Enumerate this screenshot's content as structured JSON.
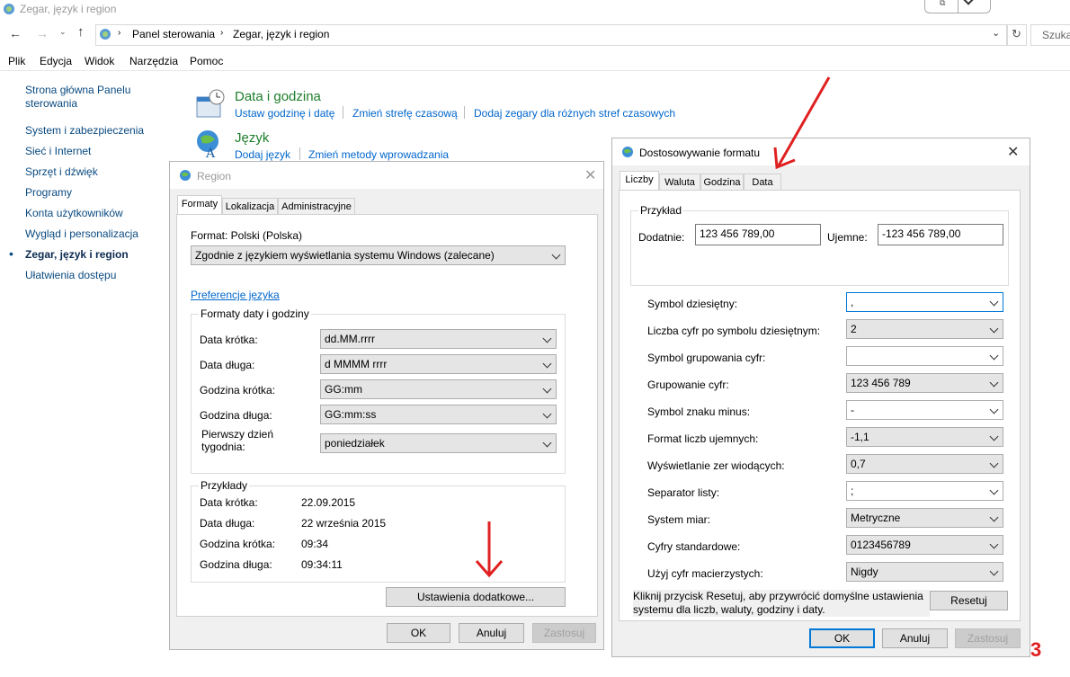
{
  "window": {
    "title": "Zegar, język i region",
    "search_placeholder": "Szuka"
  },
  "breadcrumb": {
    "root": "Panel sterowania",
    "current": "Zegar, język i region"
  },
  "menu": [
    "Plik",
    "Edycja",
    "Widok",
    "Narzędzia",
    "Pomoc"
  ],
  "sidebar": [
    {
      "label": "Strona główna Panelu sterowania"
    },
    {
      "label": "System i zabezpieczenia"
    },
    {
      "label": "Sieć i Internet"
    },
    {
      "label": "Sprzęt i dźwięk"
    },
    {
      "label": "Programy"
    },
    {
      "label": "Konta użytkowników"
    },
    {
      "label": "Wygląd i personalizacja"
    },
    {
      "label": "Zegar, język i region"
    },
    {
      "label": "Ułatwienia dostępu"
    }
  ],
  "categories": {
    "datetime": {
      "title": "Data i godzina",
      "links": [
        "Ustaw godzinę i datę",
        "Zmień strefę czasową",
        "Dodaj zegary dla różnych stref czasowych"
      ]
    },
    "language": {
      "title": "Język",
      "links": [
        "Dodaj język",
        "Zmień metody wprowadzania"
      ]
    }
  },
  "region": {
    "title": "Region",
    "tabs": [
      "Formaty",
      "Lokalizacja",
      "Administracyjne"
    ],
    "format_label": "Format: Polski (Polska)",
    "format_value": "Zgodnie z językiem wyświetlania systemu Windows (zalecane)",
    "pref_link": "Preferencje języka",
    "formats_group": "Formaty daty i godziny",
    "fields": [
      {
        "label": "Data krótka:",
        "value": "dd.MM.rrrr"
      },
      {
        "label": "Data długa:",
        "value": "d MMMM rrrr"
      },
      {
        "label": "Godzina krótka:",
        "value": "GG:mm"
      },
      {
        "label": "Godzina długa:",
        "value": "GG:mm:ss"
      },
      {
        "label": "Pierwszy dzień tygodnia:",
        "value": "poniedziałek"
      }
    ],
    "examples_group": "Przykłady",
    "examples": [
      {
        "label": "Data krótka:",
        "value": "22.09.2015"
      },
      {
        "label": "Data długa:",
        "value": "22 września 2015"
      },
      {
        "label": "Godzina krótka:",
        "value": "09:34"
      },
      {
        "label": "Godzina długa:",
        "value": "09:34:11"
      }
    ],
    "advanced_button": "Ustawienia dodatkowe...",
    "ok": "OK",
    "cancel": "Anuluj",
    "apply": "Zastosuj"
  },
  "custom": {
    "title": "Dostosowywanie formatu",
    "tabs": [
      "Liczby",
      "Waluta",
      "Godzina",
      "Data"
    ],
    "example_group": "Przykład",
    "positive_label": "Dodatnie:",
    "positive_value": "123 456 789,00",
    "negative_label": "Ujemne:",
    "negative_value": "-123 456 789,00",
    "rows": [
      {
        "label": "Symbol dziesiętny:",
        "value": ","
      },
      {
        "label": "Liczba cyfr po symbolu dziesiętnym:",
        "value": "2"
      },
      {
        "label": "Symbol grupowania cyfr:",
        "value": ""
      },
      {
        "label": "Grupowanie cyfr:",
        "value": "123 456 789"
      },
      {
        "label": "Symbol znaku minus:",
        "value": "-"
      },
      {
        "label": "Format liczb ujemnych:",
        "value": "-1,1"
      },
      {
        "label": "Wyświetlanie zer wiodących:",
        "value": "0,7"
      },
      {
        "label": "Separator listy:",
        "value": ";"
      },
      {
        "label": "System miar:",
        "value": "Metryczne"
      },
      {
        "label": "Cyfry standardowe:",
        "value": "0123456789"
      },
      {
        "label": "Użyj cyfr macierzystych:",
        "value": "Nigdy"
      }
    ],
    "reset_text": "Kliknij przycisk Resetuj, aby przywrócić domyślne ustawienia systemu dla liczb, waluty, godziny i daty.",
    "reset_button": "Resetuj",
    "ok": "OK",
    "cancel": "Anuluj",
    "apply": "Zastosuj"
  },
  "annotation": "3",
  "colors": {
    "accent": "#0078d7",
    "link": "#0066cc",
    "category_title": "#1e7e2a",
    "arrow": "#e02020"
  }
}
